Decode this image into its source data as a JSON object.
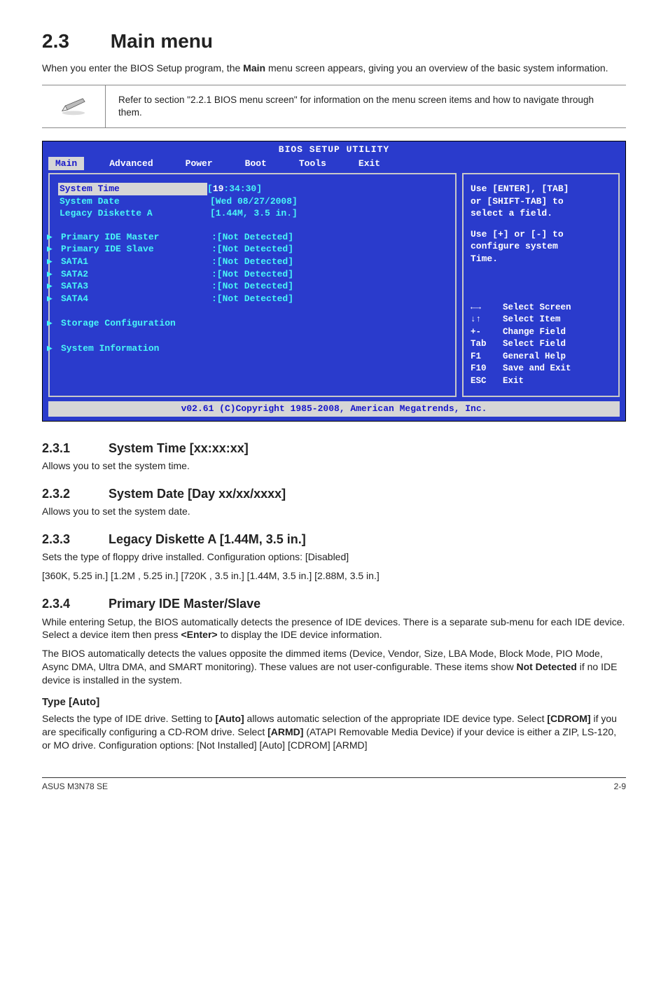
{
  "section": {
    "number": "2.3",
    "title": "Main menu"
  },
  "intro": "When you enter the BIOS Setup program, the Main menu screen appears, giving you an overview of the basic system information.",
  "intro_bold": "Main",
  "note": "Refer to section \"2.2.1 BIOS menu screen\" for information on the menu screen items and how to navigate through them.",
  "bios": {
    "title": "BIOS SETUP UTILITY",
    "tabs": [
      "Main",
      "Advanced",
      "Power",
      "Boot",
      "Tools",
      "Exit"
    ],
    "fields": {
      "system_time_label": "System Time",
      "system_time_val_pre": "[",
      "system_time_hh": "19",
      "system_time_rest": ":34:30]",
      "system_date_label": "System Date",
      "system_date_val": "[Wed 08/27/2008]",
      "legacy_label": "Legacy Diskette A",
      "legacy_val": "[1.44M, 3.5 in.]",
      "pide_master_label": "Primary IDE Master",
      "pide_master_val": ":[Not Detected]",
      "pide_slave_label": "Primary IDE Slave",
      "pide_slave_val": ":[Not Detected]",
      "sata1_label": "SATA1",
      "sata1_val": ":[Not Detected]",
      "sata2_label": "SATA2",
      "sata2_val": ":[Not Detected]",
      "sata3_label": "SATA3",
      "sata3_val": ":[Not Detected]",
      "sata4_label": "SATA4",
      "sata4_val": ":[Not Detected]",
      "storage_label": "Storage Configuration",
      "sysinfo_label": "System Information"
    },
    "help_top_l1": "Use [ENTER], [TAB]",
    "help_top_l2": "or [SHIFT-TAB] to",
    "help_top_l3": "select a field.",
    "help_top_l4": "Use [+] or [-] to",
    "help_top_l5": "configure system",
    "help_top_l6": "Time.",
    "help_keys": [
      {
        "k": "←→",
        "v": "Select Screen"
      },
      {
        "k": "↓↑",
        "v": "Select Item"
      },
      {
        "k": "+-",
        "v": "Change Field"
      },
      {
        "k": "Tab",
        "v": "Select Field"
      },
      {
        "k": "F1",
        "v": "General Help"
      },
      {
        "k": "F10",
        "v": "Save and Exit"
      },
      {
        "k": "ESC",
        "v": "Exit"
      }
    ],
    "footer": "v02.61 (C)Copyright 1985-2008, American Megatrends, Inc."
  },
  "sub1": {
    "num": "2.3.1",
    "title": "System Time [xx:xx:xx]",
    "body": "Allows you to set the system time."
  },
  "sub2": {
    "num": "2.3.2",
    "title": "System Date [Day xx/xx/xxxx]",
    "body": "Allows you to set the system date."
  },
  "sub3": {
    "num": "2.3.3",
    "title": "Legacy Diskette A [1.44M, 3.5 in.]",
    "body1": "Sets the type of floppy drive installed. Configuration options: [Disabled]",
    "body2": "[360K, 5.25 in.] [1.2M , 5.25 in.] [720K , 3.5 in.] [1.44M, 3.5 in.] [2.88M, 3.5 in.]"
  },
  "sub4": {
    "num": "2.3.4",
    "title": "Primary IDE Master/Slave",
    "p1a": "While entering Setup, the BIOS automatically detects the presence of IDE devices. There is a separate sub-menu for each IDE device. Select a device item then press ",
    "p1b": "<Enter>",
    "p1c": " to display the IDE device information.",
    "p2a": "The BIOS automatically detects the values opposite the dimmed items (Device, Vendor, Size, LBA Mode, Block Mode, PIO Mode, Async DMA, Ultra DMA, and SMART monitoring). These values are not user-configurable. These items show ",
    "p2b": "Not Detected",
    "p2c": " if no IDE device is installed in the system.",
    "type_h": "Type [Auto]",
    "type_p_a": "Selects the type of IDE drive. Setting to ",
    "type_p_b": "[Auto]",
    "type_p_c": " allows automatic selection of the appropriate IDE device type. Select ",
    "type_p_d": "[CDROM]",
    "type_p_e": " if you are specifically configuring a CD-ROM drive. Select ",
    "type_p_f": "[ARMD]",
    "type_p_g": " (ATAPI Removable Media Device) if your device is either a ZIP, LS-120, or MO drive. Configuration options: [Not Installed] [Auto] [CDROM] [ARMD]"
  },
  "footer": {
    "left": "ASUS M3N78 SE",
    "right": "2-9"
  }
}
